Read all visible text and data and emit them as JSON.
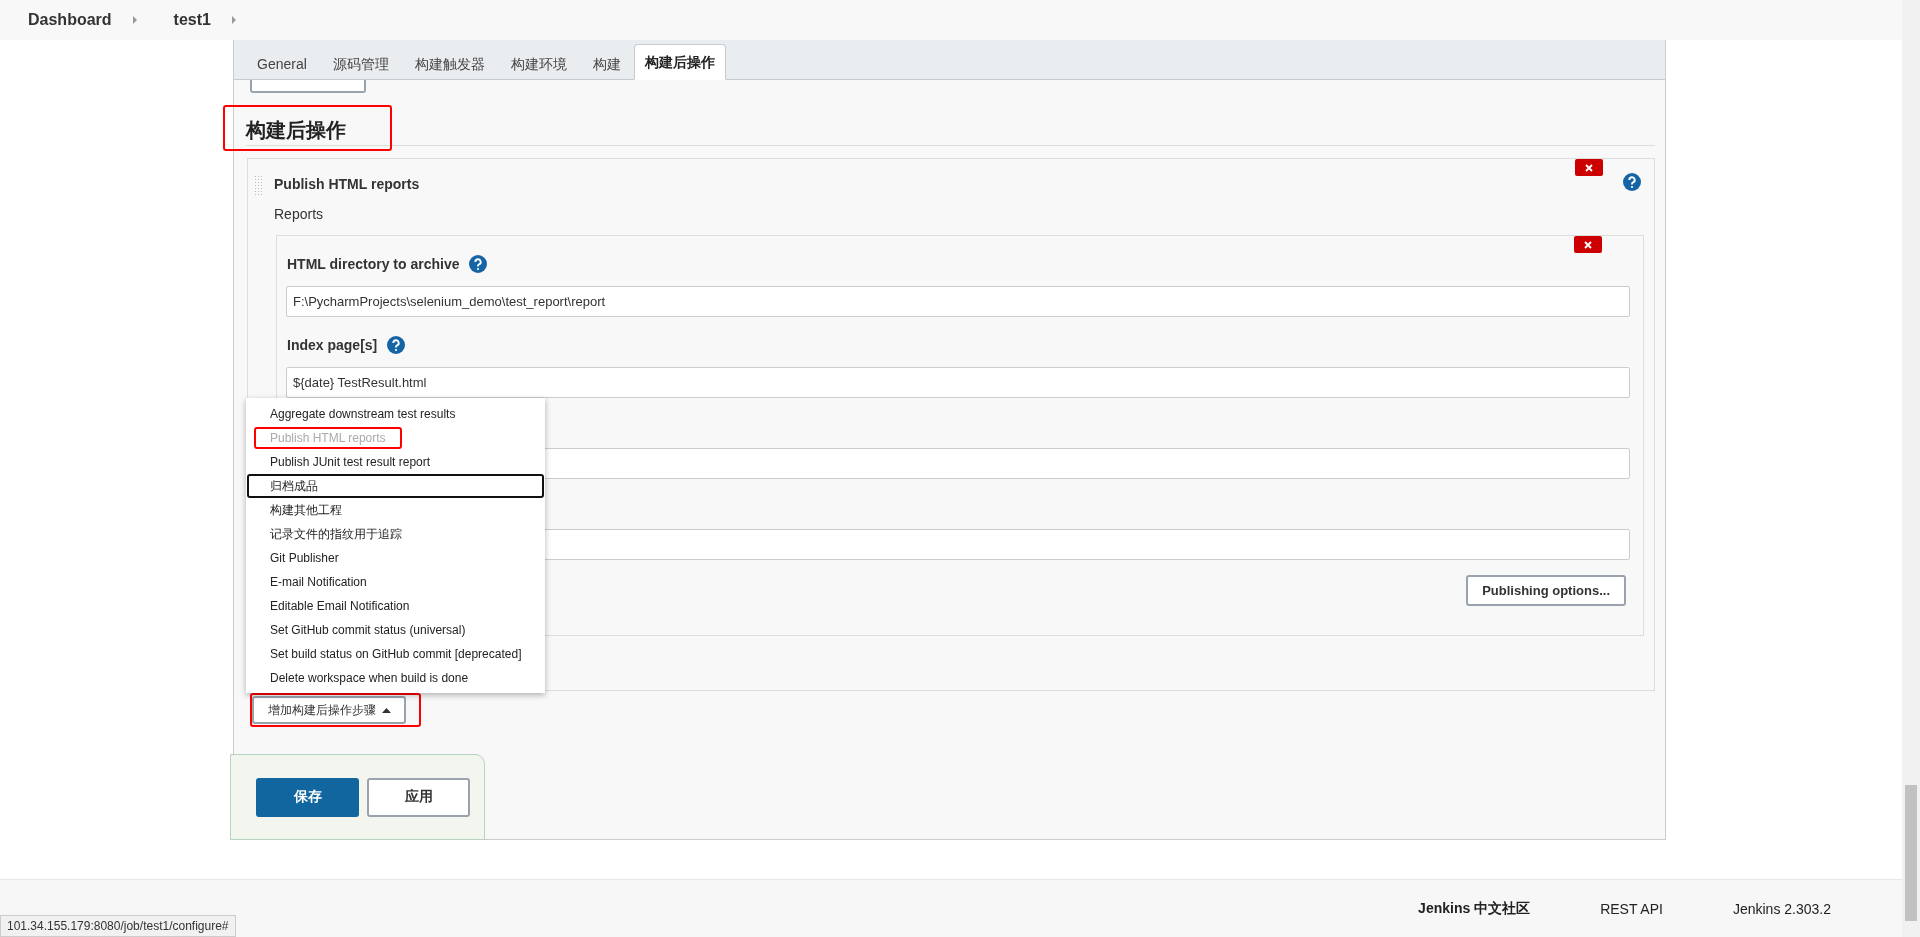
{
  "breadcrumb": [
    {
      "label": "Dashboard"
    },
    {
      "label": "test1"
    }
  ],
  "tabs": [
    {
      "label": "General",
      "selected": false
    },
    {
      "label": "源码管理",
      "selected": false
    },
    {
      "label": "构建触发器",
      "selected": false
    },
    {
      "label": "构建环境",
      "selected": false
    },
    {
      "label": "构建",
      "selected": false
    },
    {
      "label": "构建后操作",
      "selected": true
    }
  ],
  "section": {
    "title": "构建后操作",
    "highlighted": true
  },
  "publisher": {
    "title": "Publish HTML reports",
    "reports_label": "Reports",
    "fields": [
      {
        "label": "HTML directory to archive",
        "value": "F:\\PycharmProjects\\selenium_demo\\test_report\\report",
        "help": true
      },
      {
        "label": "Index page[s]",
        "value": "${date} TestResult.html",
        "help": true
      }
    ],
    "publishing_options_button": "Publishing options..."
  },
  "menu": {
    "items": [
      {
        "label": "Aggregate downstream test results",
        "disabled": false,
        "focused": false,
        "highlighted": false
      },
      {
        "label": "Publish HTML reports",
        "disabled": true,
        "focused": false,
        "highlighted": true
      },
      {
        "label": "Publish JUnit test result report",
        "disabled": false,
        "focused": false,
        "highlighted": false
      },
      {
        "label": "归档成品",
        "disabled": false,
        "focused": true,
        "highlighted": false
      },
      {
        "label": "构建其他工程",
        "disabled": false,
        "focused": false,
        "highlighted": false
      },
      {
        "label": "记录文件的指纹用于追踪",
        "disabled": false,
        "focused": false,
        "highlighted": false
      },
      {
        "label": "Git Publisher",
        "disabled": false,
        "focused": false,
        "highlighted": false
      },
      {
        "label": "E-mail Notification",
        "disabled": false,
        "focused": false,
        "highlighted": false
      },
      {
        "label": "Editable Email Notification",
        "disabled": false,
        "focused": false,
        "highlighted": false
      },
      {
        "label": "Set GitHub commit status (universal)",
        "disabled": false,
        "focused": false,
        "highlighted": false
      },
      {
        "label": "Set build status on GitHub commit [deprecated]",
        "disabled": false,
        "focused": false,
        "highlighted": false
      },
      {
        "label": "Delete workspace when build is done",
        "disabled": false,
        "focused": false,
        "highlighted": false
      }
    ]
  },
  "add_step_button": {
    "label": "增加构建后操作步骤",
    "highlighted": true
  },
  "save_button": "保存",
  "apply_button": "应用",
  "footer": {
    "links": [
      "Jenkins 中文社区",
      "REST API",
      "Jenkins 2.303.2"
    ]
  },
  "status_url": "101.34.155.179:8080/job/test1/configure#"
}
